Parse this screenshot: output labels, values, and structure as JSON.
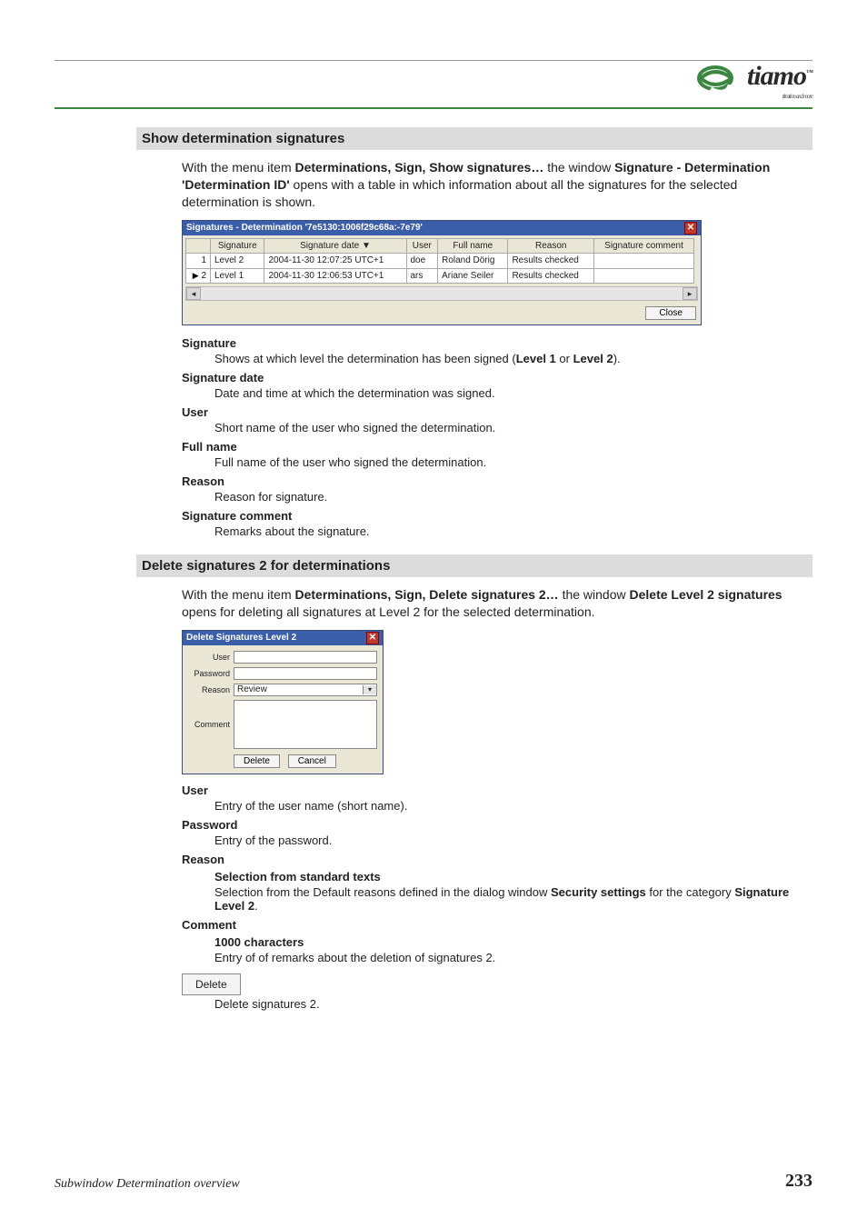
{
  "logo": {
    "text": "tiamo",
    "tagline": "titration and more"
  },
  "section1": {
    "heading": "Show determination signatures",
    "para_pre": "With the menu item ",
    "menu_bold": "Determinations, Sign, Show signatures…",
    "para_mid": " the window ",
    "window_bold": "Signature - Determination 'Determination ID'",
    "para_post": " opens with a table in which information about all the signatures for the selected determination is shown."
  },
  "sig_window": {
    "title": "Signatures - Determination '7e5130:1006f29c68a:-7e79'",
    "headers": [
      "",
      "Signature",
      "Signature date ▼",
      "User",
      "Full name",
      "Reason",
      "Signature comment"
    ],
    "rows": [
      {
        "mark": "",
        "n": "1",
        "sig": "Level 2",
        "date": "2004-11-30 12:07:25 UTC+1",
        "user": "doe",
        "full": "Roland Dörig",
        "reason": "Results checked",
        "comment": ""
      },
      {
        "mark": "▶",
        "n": "2",
        "sig": "Level 1",
        "date": "2004-11-30 12:06:53 UTC+1",
        "user": "ars",
        "full": "Ariane Seiler",
        "reason": "Results checked",
        "comment": ""
      }
    ],
    "close_btn": "Close"
  },
  "defs1": {
    "sig_t": "Signature",
    "sig_d_pre": "Shows at which level the determination has been signed (",
    "sig_d_b1": "Level 1",
    "sig_d_or": " or ",
    "sig_d_b2": "Level 2",
    "sig_d_post": ").",
    "date_t": "Signature date",
    "date_d": "Date and time at which the determination was signed.",
    "user_t": "User",
    "user_d": "Short name of the user who signed the determination.",
    "full_t": "Full name",
    "full_d": "Full name of the user who signed the determination.",
    "reason_t": "Reason",
    "reason_d": "Reason for signature.",
    "comment_t": "Signature comment",
    "comment_d": "Remarks about the signature."
  },
  "section2": {
    "heading": "Delete signatures 2 for determinations",
    "para_pre": "With the menu item ",
    "menu_bold": "Determinations, Sign, Delete signatures 2…",
    "para_mid": " the window ",
    "window_bold": "Delete Level 2 signatures",
    "para_post": " opens for deleting all signatures at Level 2 for the selected determination."
  },
  "del_window": {
    "title": "Delete Signatures Level 2",
    "user_lbl": "User",
    "password_lbl": "Password",
    "reason_lbl": "Reason",
    "reason_val": "Review",
    "comment_lbl": "Comment",
    "delete_btn": "Delete",
    "cancel_btn": "Cancel"
  },
  "defs2": {
    "user_t": "User",
    "user_d": "Entry of the user name (short name).",
    "pw_t": "Password",
    "pw_d": "Entry of the password.",
    "reason_t": "Reason",
    "reason_sub": "Selection from standard texts",
    "reason_d_pre": "Selection from the Default reasons defined in the dialog window ",
    "reason_d_b1": "Security settings",
    "reason_d_mid": " for the category ",
    "reason_d_b2": "Signature Level 2",
    "reason_d_post": ".",
    "comment_t": "Comment",
    "comment_sub": "1000 characters",
    "comment_d": "Entry of of remarks about the deletion of signatures 2.",
    "delete_pill": "Delete",
    "delete_d": "Delete signatures 2."
  },
  "footer": {
    "left": "Subwindow Determination overview",
    "right": "233"
  }
}
